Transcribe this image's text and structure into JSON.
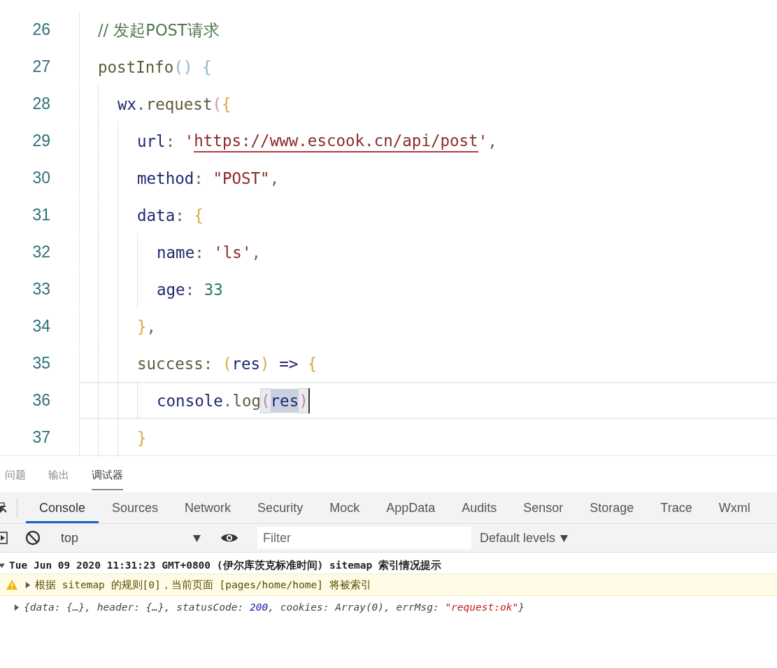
{
  "editor": {
    "lines": [
      {
        "number": "26",
        "current": false,
        "tokens": [
          {
            "kind": "comment",
            "text": "// 发起POST请求"
          }
        ]
      },
      {
        "number": "27",
        "current": false,
        "tokens": [
          {
            "kind": "func",
            "text": "postInfo"
          },
          {
            "kind": "bracket",
            "text": "() {"
          }
        ],
        "children": [
          {
            "number": "28",
            "current": false,
            "tokens": [
              {
                "kind": "var",
                "text": "wx"
              },
              {
                "kind": "punct",
                "text": "."
              },
              {
                "kind": "method",
                "text": "request"
              },
              {
                "kind": "paren",
                "text": "("
              },
              {
                "kind": "brace",
                "text": "{"
              }
            ],
            "children": [
              {
                "number": "29",
                "current": false,
                "tokens": [
                  {
                    "kind": "prop",
                    "text": "url"
                  },
                  {
                    "kind": "punct",
                    "text": ": "
                  },
                  {
                    "kind": "string",
                    "text": "'"
                  },
                  {
                    "kind": "link",
                    "text": "https://www.escook.cn/api/post"
                  },
                  {
                    "kind": "string",
                    "text": "'"
                  },
                  {
                    "kind": "punct",
                    "text": ","
                  }
                ]
              },
              {
                "number": "30",
                "current": false,
                "tokens": [
                  {
                    "kind": "prop",
                    "text": "method"
                  },
                  {
                    "kind": "punct",
                    "text": ": "
                  },
                  {
                    "kind": "string",
                    "text": "\"POST\""
                  },
                  {
                    "kind": "punct",
                    "text": ","
                  }
                ]
              },
              {
                "number": "31",
                "current": false,
                "tokens": [
                  {
                    "kind": "prop",
                    "text": "data"
                  },
                  {
                    "kind": "punct",
                    "text": ": "
                  },
                  {
                    "kind": "brace",
                    "text": "{"
                  }
                ],
                "children": [
                  {
                    "number": "32",
                    "current": false,
                    "tokens": [
                      {
                        "kind": "prop",
                        "text": "name"
                      },
                      {
                        "kind": "punct",
                        "text": ": "
                      },
                      {
                        "kind": "string",
                        "text": "'ls'"
                      },
                      {
                        "kind": "punct",
                        "text": ","
                      }
                    ]
                  },
                  {
                    "number": "33",
                    "current": false,
                    "tokens": [
                      {
                        "kind": "prop",
                        "text": "age"
                      },
                      {
                        "kind": "punct",
                        "text": ": "
                      },
                      {
                        "kind": "number",
                        "text": "33"
                      }
                    ]
                  }
                ]
              },
              {
                "number": "34",
                "current": false,
                "tokens": [
                  {
                    "kind": "brace",
                    "text": "}"
                  },
                  {
                    "kind": "punct",
                    "text": ","
                  }
                ]
              },
              {
                "number": "35",
                "current": false,
                "tokens": [
                  {
                    "kind": "method",
                    "text": "success"
                  },
                  {
                    "kind": "punct",
                    "text": ": "
                  },
                  {
                    "kind": "brace",
                    "text": "("
                  },
                  {
                    "kind": "var",
                    "text": "res"
                  },
                  {
                    "kind": "brace",
                    "text": ")"
                  },
                  {
                    "kind": "var",
                    "text": " => "
                  },
                  {
                    "kind": "brace",
                    "text": "{"
                  }
                ],
                "children": [
                  {
                    "number": "36",
                    "current": true,
                    "tokens": [
                      {
                        "kind": "var",
                        "text": "console"
                      },
                      {
                        "kind": "punct",
                        "text": "."
                      },
                      {
                        "kind": "method",
                        "text": "log"
                      },
                      {
                        "kind": "match",
                        "text": "("
                      },
                      {
                        "kind": "selection",
                        "text": "res"
                      },
                      {
                        "kind": "match",
                        "text": ")"
                      }
                    ]
                  }
                ]
              },
              {
                "number": "37",
                "current": false,
                "tokens": [
                  {
                    "kind": "brace",
                    "text": "}"
                  }
                ]
              }
            ]
          }
        ]
      }
    ]
  },
  "panel_tabs": [
    {
      "label": "问题",
      "selected": false
    },
    {
      "label": "输出",
      "selected": false
    },
    {
      "label": "调试器",
      "selected": true
    }
  ],
  "devtools_tabs": [
    {
      "label": "Console",
      "selected": true
    },
    {
      "label": "Sources",
      "selected": false
    },
    {
      "label": "Network",
      "selected": false
    },
    {
      "label": "Security",
      "selected": false
    },
    {
      "label": "Mock",
      "selected": false
    },
    {
      "label": "AppData",
      "selected": false
    },
    {
      "label": "Audits",
      "selected": false
    },
    {
      "label": "Sensor",
      "selected": false
    },
    {
      "label": "Storage",
      "selected": false
    },
    {
      "label": "Trace",
      "selected": false
    },
    {
      "label": "Wxml",
      "selected": false
    }
  ],
  "toolbar": {
    "context": "top",
    "filter": {
      "placeholder": "Filter"
    },
    "levels": "Default levels"
  },
  "console": [
    {
      "kind": "group",
      "expanded": true,
      "tokens": [
        {
          "kind": "plain",
          "text": "Tue Jun 09 2020 11:31:23 GMT+0800 (伊尔库茨克标准时间) sitemap 索引情况提示"
        }
      ]
    },
    {
      "kind": "warning",
      "expanded": false,
      "tokens": [
        {
          "kind": "plain",
          "text": "根据 sitemap 的规则[0]，当前页面 [pages/home/home] 将被索引"
        }
      ]
    },
    {
      "kind": "log",
      "expanded": false,
      "tokens": [
        {
          "kind": "plain",
          "text": "{data: {…}, header: {…}, statusCode: "
        },
        {
          "kind": "number",
          "text": "200"
        },
        {
          "kind": "plain",
          "text": ", cookies: Array(0), errMsg: "
        },
        {
          "kind": "string",
          "text": "\"request:ok\""
        },
        {
          "kind": "plain",
          "text": "}"
        }
      ]
    }
  ]
}
